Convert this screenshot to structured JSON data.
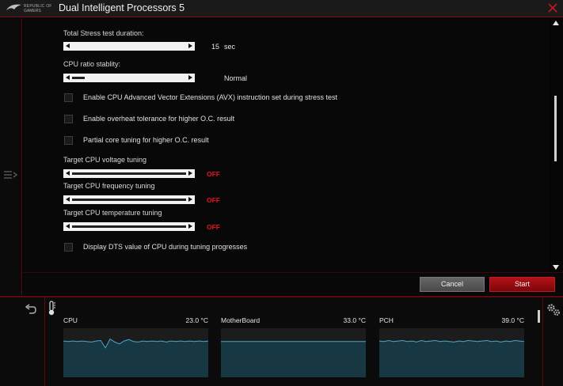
{
  "window": {
    "title": "Dual Intelligent Processors 5",
    "logo_line1": "REPUBLIC OF",
    "logo_line2": "GAMERS"
  },
  "stress_duration": {
    "label": "Total Stress test duration:",
    "value": "15",
    "unit": "sec"
  },
  "ratio_stability": {
    "label": "CPU ratio stablity:",
    "value": "Normal"
  },
  "options": [
    {
      "label": "Enable CPU Advanced Vector Extensions (AVX) instruction set during stress test",
      "checked": false
    },
    {
      "label": "Enable overheat tolerance for higher O.C. result",
      "checked": false
    },
    {
      "label": "Partial core tuning for higher O.C. result",
      "checked": false
    }
  ],
  "tuning": [
    {
      "label": "Target CPU voltage tuning",
      "value": "OFF"
    },
    {
      "label": "Target CPU frequency tuning",
      "value": "OFF"
    },
    {
      "label": "Target CPU temperature tuning",
      "value": "OFF"
    }
  ],
  "dts_option": {
    "label": "Display DTS value of CPU during tuning progresses",
    "checked": false
  },
  "buttons": {
    "cancel": "Cancel",
    "start": "Start"
  },
  "colors": {
    "accent_red": "#e0141b",
    "graph_line": "#4aa8c8"
  },
  "icons": {
    "close": "close-icon",
    "menu": "menu-icon",
    "back": "back-icon",
    "thermometer": "thermometer-icon",
    "settings": "settings-icon"
  },
  "monitor": [
    {
      "name": "CPU",
      "temp": "23.0 °C",
      "trace": [
        0.26,
        0.27,
        0.26,
        0.27,
        0.26,
        0.27,
        0.28,
        0.26,
        0.25,
        0.4,
        0.22,
        0.28,
        0.32,
        0.26,
        0.23,
        0.27,
        0.28,
        0.26,
        0.27,
        0.26,
        0.27,
        0.26,
        0.28,
        0.26,
        0.27,
        0.26,
        0.27,
        0.26,
        0.27,
        0.26,
        0.27,
        0.26
      ]
    },
    {
      "name": "MotherBoard",
      "temp": "33.0 °C",
      "trace": [
        0.27,
        0.27,
        0.27,
        0.27,
        0.27,
        0.27,
        0.27,
        0.27,
        0.27,
        0.27,
        0.27,
        0.27,
        0.27,
        0.27,
        0.27,
        0.27,
        0.27,
        0.27,
        0.27,
        0.27,
        0.27,
        0.27,
        0.27,
        0.27,
        0.27,
        0.27,
        0.27,
        0.27,
        0.27,
        0.27,
        0.27,
        0.27
      ]
    },
    {
      "name": "PCH",
      "temp": "39.0 °C",
      "trace": [
        0.26,
        0.27,
        0.25,
        0.27,
        0.26,
        0.25,
        0.27,
        0.26,
        0.28,
        0.25,
        0.27,
        0.26,
        0.25,
        0.27,
        0.26,
        0.27,
        0.28,
        0.26,
        0.27,
        0.25,
        0.26,
        0.27,
        0.26,
        0.25,
        0.27,
        0.26,
        0.28,
        0.26,
        0.27,
        0.25,
        0.26,
        0.27
      ]
    }
  ]
}
